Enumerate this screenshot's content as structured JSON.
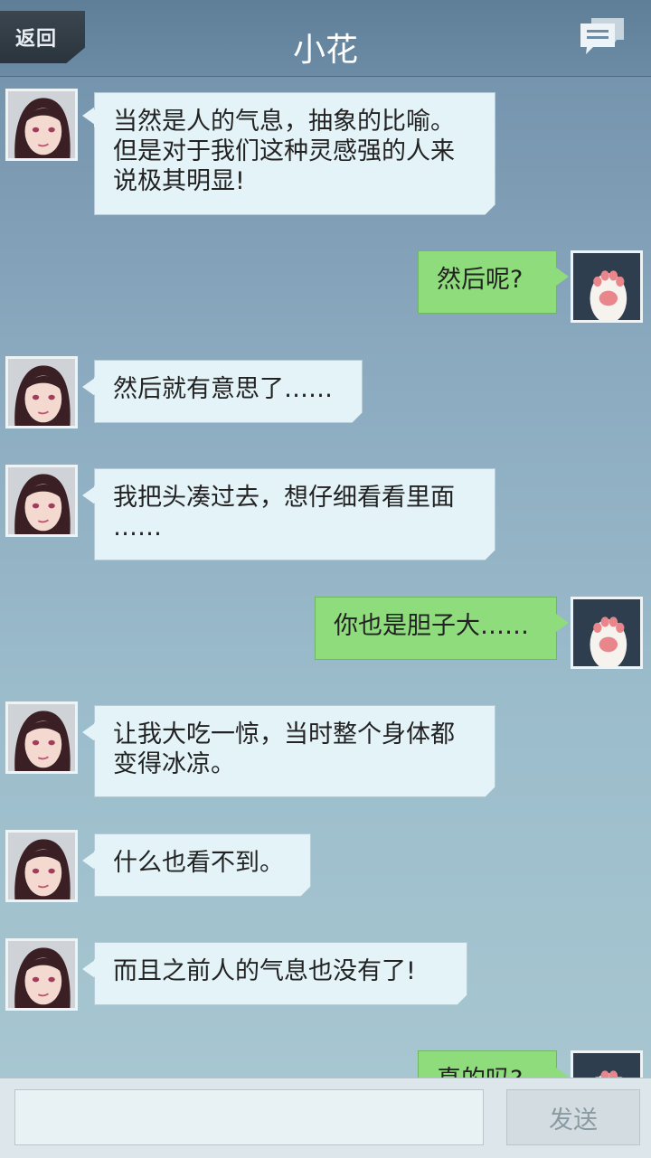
{
  "header": {
    "back_label": "返回",
    "title": "小花",
    "menu_icon": "chat-bubbles-icon"
  },
  "messages": [
    {
      "side": "incoming",
      "text": "当然是人的气息，抽象的比喻。\n但是对于我们这种灵感强的人来\n说极其明显!"
    },
    {
      "side": "outgoing",
      "text": "然后呢?"
    },
    {
      "side": "incoming",
      "text": "然后就有意思了……"
    },
    {
      "side": "incoming",
      "text": "我把头凑过去，想仔细看看里面\n……"
    },
    {
      "side": "outgoing",
      "text": "你也是胆子大……"
    },
    {
      "side": "incoming",
      "text": "让我大吃一惊，当时整个身体都\n变得冰凉。"
    },
    {
      "side": "incoming",
      "text": "什么也看不到。"
    },
    {
      "side": "incoming",
      "text": "而且之前人的气息也没有了!"
    },
    {
      "side": "outgoing",
      "text": "真的吗?"
    }
  ],
  "input": {
    "value": "",
    "send_label": "发送"
  },
  "colors": {
    "incoming_bubble": "#e3f3f8",
    "outgoing_bubble": "#8fdc7d",
    "header": "#6c8ba5"
  }
}
